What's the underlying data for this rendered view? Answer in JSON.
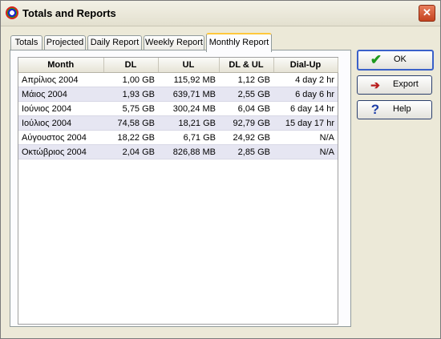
{
  "window": {
    "title": "Totals and Reports",
    "close_label": "✕"
  },
  "tabs": [
    {
      "label": "Totals",
      "active": false
    },
    {
      "label": "Projected",
      "active": false
    },
    {
      "label": "Daily Report",
      "active": false
    },
    {
      "label": "Weekly Report",
      "active": false
    },
    {
      "label": "Monthly Report",
      "active": true
    }
  ],
  "table": {
    "columns": [
      "Month",
      "DL",
      "UL",
      "DL & UL",
      "Dial-Up"
    ],
    "rows": [
      [
        "Απρίλιος 2004",
        "1,00 GB",
        "115,92 MB",
        "1,12 GB",
        "4 day 2 hr"
      ],
      [
        "Μάιος 2004",
        "1,93 GB",
        "639,71 MB",
        "2,55 GB",
        "6 day 6 hr"
      ],
      [
        "Ιούνιος 2004",
        "5,75 GB",
        "300,24 MB",
        "6,04 GB",
        "6 day 14 hr"
      ],
      [
        "Ιούλιος 2004",
        "74,58 GB",
        "18,21 GB",
        "92,79 GB",
        "15 day 17 hr"
      ],
      [
        "Αύγουστος 2004",
        "18,22 GB",
        "6,71 GB",
        "24,92 GB",
        "N/A"
      ],
      [
        "Οκτώβριος 2004",
        "2,04 GB",
        "826,88 MB",
        "2,85 GB",
        "N/A"
      ]
    ]
  },
  "buttons": {
    "ok": {
      "label": "OK",
      "icon": "checkmark-icon"
    },
    "export": {
      "label": "Export",
      "icon": "export-icon"
    },
    "help": {
      "label": "Help",
      "icon": "help-icon"
    }
  },
  "colors": {
    "alt_row": "#e6e6f2",
    "active_tab_accent": "#ffc83c"
  }
}
